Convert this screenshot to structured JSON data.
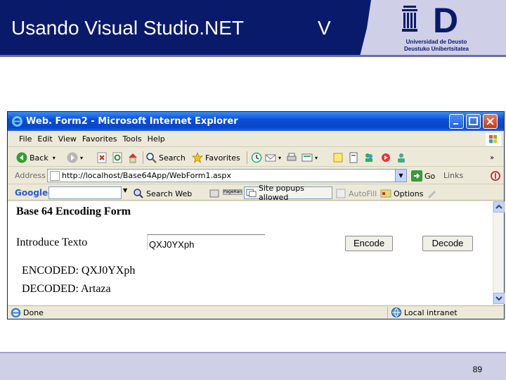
{
  "slide": {
    "title": "Usando Visual Studio.NET",
    "section_letter": "V",
    "page_number": "89",
    "logo": {
      "letter": "D",
      "line1": "Universidad de Deusto",
      "line2": "Deustuko Unibertsitatea"
    }
  },
  "browser": {
    "window_title": "Web. Form2 - Microsoft Internet Explorer",
    "menu": [
      "File",
      "Edit",
      "View",
      "Favorites",
      "Tools",
      "Help"
    ],
    "toolbar": {
      "back": "Back",
      "search": "Search",
      "favorites": "Favorites"
    },
    "address": {
      "label": "Address",
      "url": "http://localhost/Base64App/WebForm1.aspx",
      "go": "Go",
      "links": "Links"
    },
    "google_bar": {
      "logo": "Google",
      "search_web": "Search Web",
      "pagerank": "PageRank",
      "popups": "Site popups allowed",
      "autofill": "AutoFill",
      "options": "Options"
    },
    "status": {
      "text": "Done",
      "zone": "Local intranet"
    }
  },
  "form": {
    "title": "Base 64 Encoding Form",
    "input_label": "Introduce Texto",
    "input_value": "QXJ0YXph",
    "encode_button": "Encode",
    "decode_button": "Decode",
    "encoded_result": "ENCODED: QXJ0YXph",
    "decoded_result": "DECODED: Artaza"
  },
  "colors": {
    "header_bg": "#0a1a6b",
    "footer_bg": "#cfd0e8",
    "xp_titlebar": "#0846c8"
  }
}
